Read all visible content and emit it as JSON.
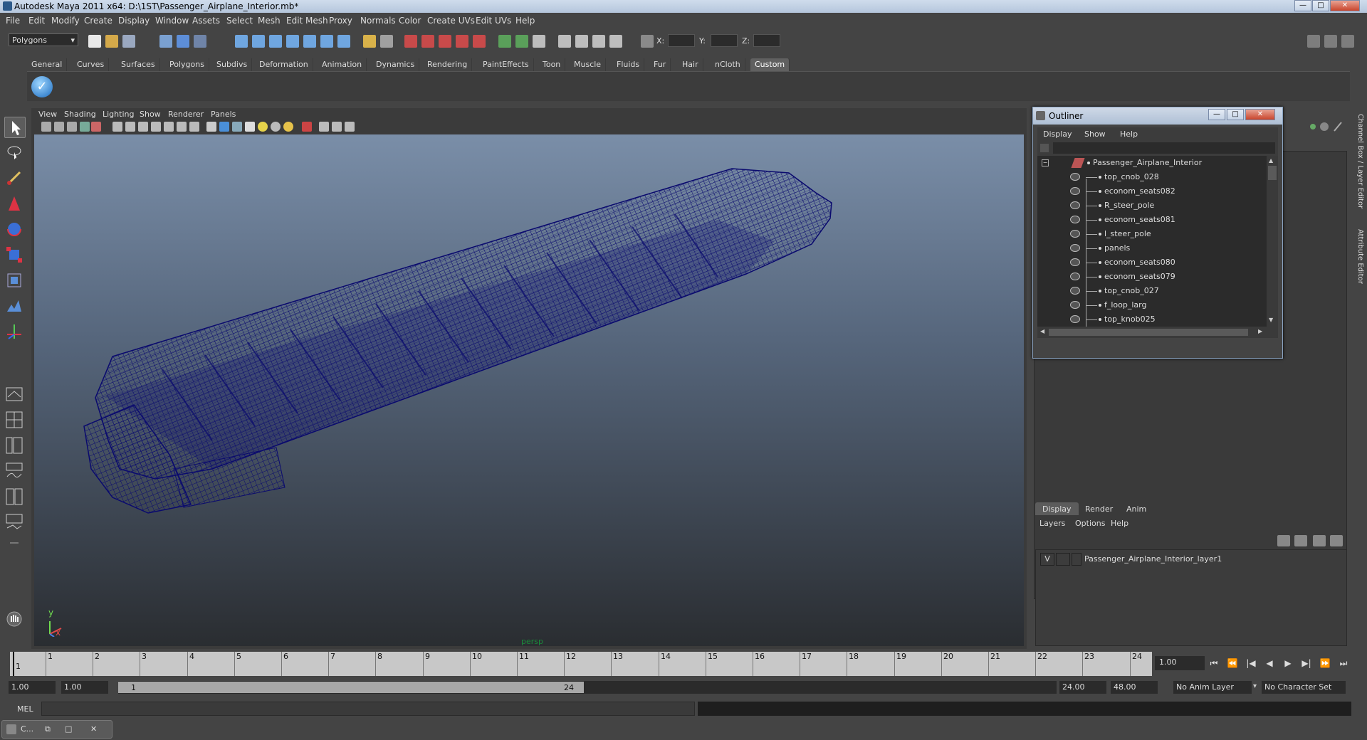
{
  "window": {
    "title": "Autodesk Maya 2011 x64: D:\\1ST\\Passenger_Airplane_Interior.mb*",
    "min": "—",
    "max": "□",
    "close": "✕"
  },
  "menubar": [
    "File",
    "Edit",
    "Modify",
    "Create",
    "Display",
    "Window",
    "Assets",
    "Select",
    "Mesh",
    "Edit Mesh",
    "Proxy",
    "Normals",
    "Color",
    "Create UVs",
    "Edit UVs",
    "Help"
  ],
  "statusline": {
    "mode": "Polygons",
    "x_label": "X:",
    "y_label": "Y:",
    "z_label": "Z:"
  },
  "shelf_tabs": [
    "General",
    "Curves",
    "Surfaces",
    "Polygons",
    "Subdivs",
    "Deformation",
    "Animation",
    "Dynamics",
    "Rendering",
    "PaintEffects",
    "Toon",
    "Muscle",
    "Fluids",
    "Fur",
    "Hair",
    "nCloth",
    "Custom"
  ],
  "shelf_active": "Custom",
  "viewport": {
    "menu": [
      "View",
      "Shading",
      "Lighting",
      "Show",
      "Renderer",
      "Panels"
    ],
    "camera": "persp",
    "axis_y": "y",
    "axis_x": "x",
    "wire_color": "#0a0a6e"
  },
  "outliner": {
    "title": "Outliner",
    "menu": [
      "Display",
      "Show",
      "Help"
    ],
    "root": "Passenger_Airplane_Interior",
    "items": [
      "top_cnob_028",
      "econom_seats082",
      "R_steer_pole",
      "econom_seats081",
      "l_steer_pole",
      "panels",
      "econom_seats080",
      "econom_seats079",
      "top_cnob_027",
      "f_loop_larg",
      "top_knob025"
    ]
  },
  "sidebar_tabs": [
    "Channel Box / Layer Editor",
    "Attribute Editor"
  ],
  "layer_editor": {
    "tabs": [
      "Display",
      "Render",
      "Anim"
    ],
    "active_tab": "Display",
    "menu": [
      "Layers",
      "Options",
      "Help"
    ],
    "layer": {
      "visible": "V",
      "name": "Passenger_Airplane_Interior_layer1"
    }
  },
  "timeslider": {
    "ticks": [
      "1",
      "2",
      "3",
      "4",
      "5",
      "6",
      "7",
      "8",
      "9",
      "10",
      "11",
      "12",
      "13",
      "14",
      "15",
      "16",
      "17",
      "18",
      "19",
      "20",
      "21",
      "22",
      "23",
      "24"
    ],
    "current_frame": "1",
    "current_time": "1.00"
  },
  "playback": [
    "⏮",
    "⏪",
    "|◀",
    "◀",
    "▶",
    "▶|",
    "⏩",
    "⏭"
  ],
  "range": {
    "start": "1.00",
    "anim_start": "1.00",
    "range_start": "1",
    "range_end": "24",
    "anim_end": "24.00",
    "end": "48.00",
    "anim_layer": "No Anim Layer",
    "character_set": "No Character Set"
  },
  "cmdline": {
    "label": "MEL"
  },
  "minibar": {
    "label": "C..."
  }
}
